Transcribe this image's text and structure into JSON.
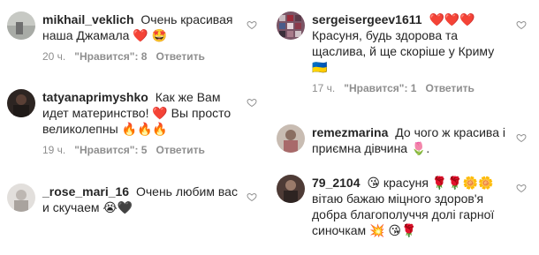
{
  "left_comments": [
    {
      "username": "mikhail_veklich",
      "text": "Очень красивая наша Джамала ❤️ 🤩",
      "time": "20 ч.",
      "likes": "\"Нравится\": 8",
      "reply": "Ответить",
      "avatar_color": "#b9bcb6"
    },
    {
      "username": "tatyanaprimyshko",
      "text": "Как же Вам идет материнство! ❤️ Вы просто великолепны 🔥🔥🔥",
      "time": "19 ч.",
      "likes": "\"Нравится\": 5",
      "reply": "Ответить",
      "avatar_color": "#3b2f2a"
    },
    {
      "username": "_rose_mari_16",
      "text": "Очень любим вас и скучаем 😭🖤",
      "avatar_color": "#d9d6d4"
    }
  ],
  "right_comments": [
    {
      "username": "sergeisergeev1611",
      "text": "❤️❤️❤️ Красуня, будь здорова та щаслива, й ще скоріше у Криму 🇺🇦",
      "time": "17 ч.",
      "likes": "\"Нравится\": 1",
      "reply": "Ответить",
      "avatar_color": "#6f4a5a"
    },
    {
      "username": "remezmarina",
      "text": "До чого ж красива і приємна дівчина 🌷.",
      "avatar_color": "#b7a99c"
    },
    {
      "username": "79_2104",
      "text": "😘 красуня 🌹🌹🌼🌼 вітаю бажаю міцного здоров'я добра благополуччя долі гарної синочкам 💥 😘🌹",
      "avatar_color": "#4a3a36"
    }
  ],
  "colors": {
    "text": "#262626",
    "meta": "#8e8e8e",
    "heart_outline": "#8e8e8e",
    "red_heart": "#ed4956"
  },
  "icons": {
    "like": "heart-outline-icon"
  }
}
